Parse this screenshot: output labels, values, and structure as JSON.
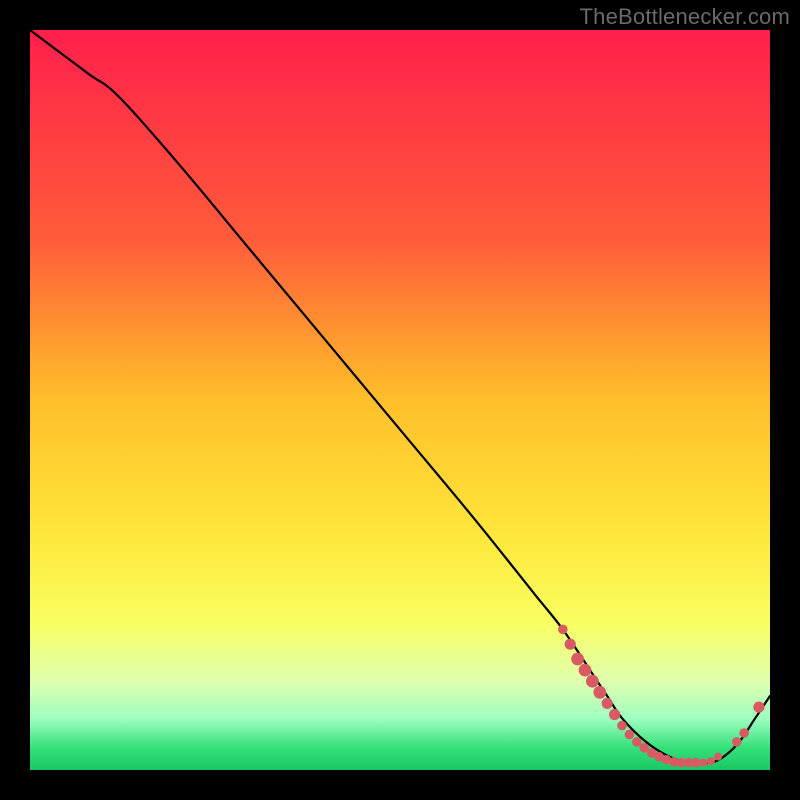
{
  "watermark": "TheBottlenecker.com",
  "chart_data": {
    "type": "line",
    "title": "",
    "xlabel": "",
    "ylabel": "",
    "xlim": [
      0,
      100
    ],
    "ylim": [
      0,
      100
    ],
    "gradient_stops": [
      {
        "offset": 0,
        "color": "#ff1f4b"
      },
      {
        "offset": 28,
        "color": "#ff5b3a"
      },
      {
        "offset": 50,
        "color": "#ffbf2a"
      },
      {
        "offset": 68,
        "color": "#ffe63a"
      },
      {
        "offset": 80,
        "color": "#f8ff60"
      },
      {
        "offset": 88,
        "color": "#dfffaf"
      },
      {
        "offset": 93,
        "color": "#9effc0"
      },
      {
        "offset": 97,
        "color": "#35e07a"
      },
      {
        "offset": 100,
        "color": "#18c765"
      }
    ],
    "series": [
      {
        "name": "bottleneck-curve",
        "x": [
          0,
          4,
          8,
          12,
          20,
          30,
          40,
          50,
          60,
          68,
          72,
          76,
          78,
          80,
          83,
          86,
          89,
          92,
          94,
          96,
          98,
          100
        ],
        "y": [
          100,
          97,
          94,
          91,
          82,
          70,
          58,
          46,
          34,
          24,
          19,
          13,
          10,
          7,
          4,
          2,
          1,
          1,
          2,
          4,
          7,
          10
        ]
      }
    ],
    "markers": {
      "name": "highlight-dots",
      "color": "#d85a63",
      "points": [
        {
          "x": 72.0,
          "y": 19.0,
          "r": 3.0
        },
        {
          "x": 73.0,
          "y": 17.0,
          "r": 3.5
        },
        {
          "x": 74.0,
          "y": 15.0,
          "r": 4.0
        },
        {
          "x": 75.0,
          "y": 13.5,
          "r": 4.0
        },
        {
          "x": 76.0,
          "y": 12.0,
          "r": 4.0
        },
        {
          "x": 77.0,
          "y": 10.5,
          "r": 4.0
        },
        {
          "x": 78.0,
          "y": 9.0,
          "r": 3.5
        },
        {
          "x": 79.0,
          "y": 7.5,
          "r": 3.5
        },
        {
          "x": 80.0,
          "y": 6.0,
          "r": 3.0
        },
        {
          "x": 81.0,
          "y": 4.8,
          "r": 3.0
        },
        {
          "x": 82.0,
          "y": 3.8,
          "r": 3.0
        },
        {
          "x": 83.0,
          "y": 3.0,
          "r": 3.0
        },
        {
          "x": 84.0,
          "y": 2.3,
          "r": 3.0
        },
        {
          "x": 85.0,
          "y": 1.8,
          "r": 3.0
        },
        {
          "x": 86.0,
          "y": 1.4,
          "r": 3.0
        },
        {
          "x": 87.0,
          "y": 1.1,
          "r": 3.0
        },
        {
          "x": 88.0,
          "y": 1.0,
          "r": 3.0
        },
        {
          "x": 89.0,
          "y": 1.0,
          "r": 3.0
        },
        {
          "x": 90.0,
          "y": 1.0,
          "r": 3.0
        },
        {
          "x": 91.0,
          "y": 1.0,
          "r": 2.5
        },
        {
          "x": 92.0,
          "y": 1.2,
          "r": 2.5
        },
        {
          "x": 93.0,
          "y": 1.8,
          "r": 2.5
        },
        {
          "x": 95.5,
          "y": 3.8,
          "r": 3.0
        },
        {
          "x": 96.5,
          "y": 5.0,
          "r": 3.0
        },
        {
          "x": 98.5,
          "y": 8.5,
          "r": 3.5
        }
      ]
    }
  }
}
